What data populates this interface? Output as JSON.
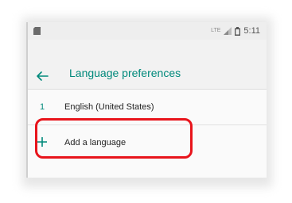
{
  "status_bar": {
    "network": "LTE",
    "time": "5:11"
  },
  "app_bar": {
    "title": "Language preferences",
    "back_icon": "arrow-back-icon"
  },
  "languages": [
    {
      "index": "1",
      "name": "English (United States)"
    }
  ],
  "add_language": {
    "icon": "plus-icon",
    "label": "Add a language"
  },
  "colors": {
    "accent": "#00897b",
    "highlight": "#e8141b"
  }
}
